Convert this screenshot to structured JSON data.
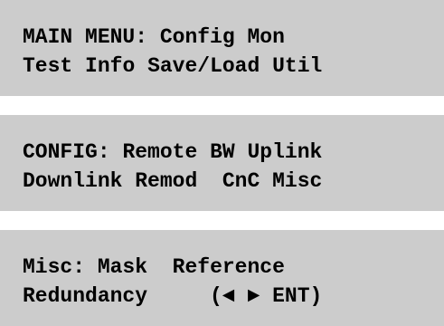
{
  "panels": [
    {
      "heading": "MAIN MENU:",
      "line1_options": [
        "Config",
        "Mon"
      ],
      "line2_options": [
        "Test",
        "Info",
        "Save/Load",
        "Util"
      ]
    },
    {
      "heading": "CONFIG:",
      "line1_options": [
        "Remote",
        "BW",
        "Uplink"
      ],
      "line2_options": [
        "Downlink",
        "Remod",
        "CnC",
        "Misc"
      ]
    },
    {
      "heading": "Misc:",
      "line1_options": [
        "Mask",
        "Reference"
      ],
      "line2_options": [
        "Redundancy"
      ],
      "nav_hint": {
        "open_paren": "(",
        "left_arrow": "◄",
        "right_arrow": "►",
        "enter": "ENT",
        "close_paren": ")"
      }
    }
  ],
  "colors": {
    "panel_background": "#cccccc",
    "text": "#000000",
    "page_background": "#ffffff"
  }
}
